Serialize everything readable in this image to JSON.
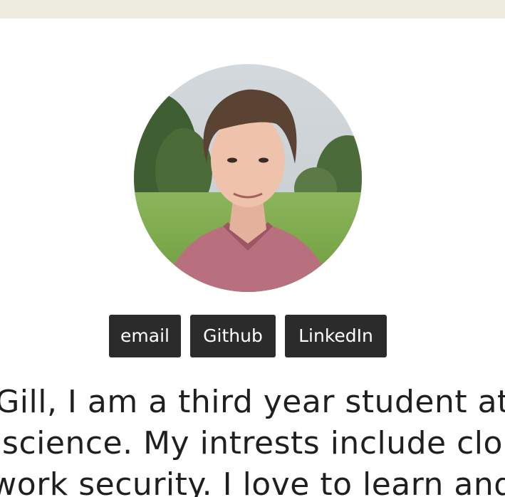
{
  "header": {
    "bar_color": "#efede1"
  },
  "profile": {
    "avatar_icon": "profile-photo"
  },
  "contact_buttons": {
    "email_label": "email",
    "github_label": "Github",
    "linkedin_label": "LinkedIn",
    "button_color": "#2b2b2b"
  },
  "bio": {
    "line1": "Gill, I am a third year student at",
    "line2": "science. My intrests include clo",
    "line3": "work security. I love to learn and"
  }
}
